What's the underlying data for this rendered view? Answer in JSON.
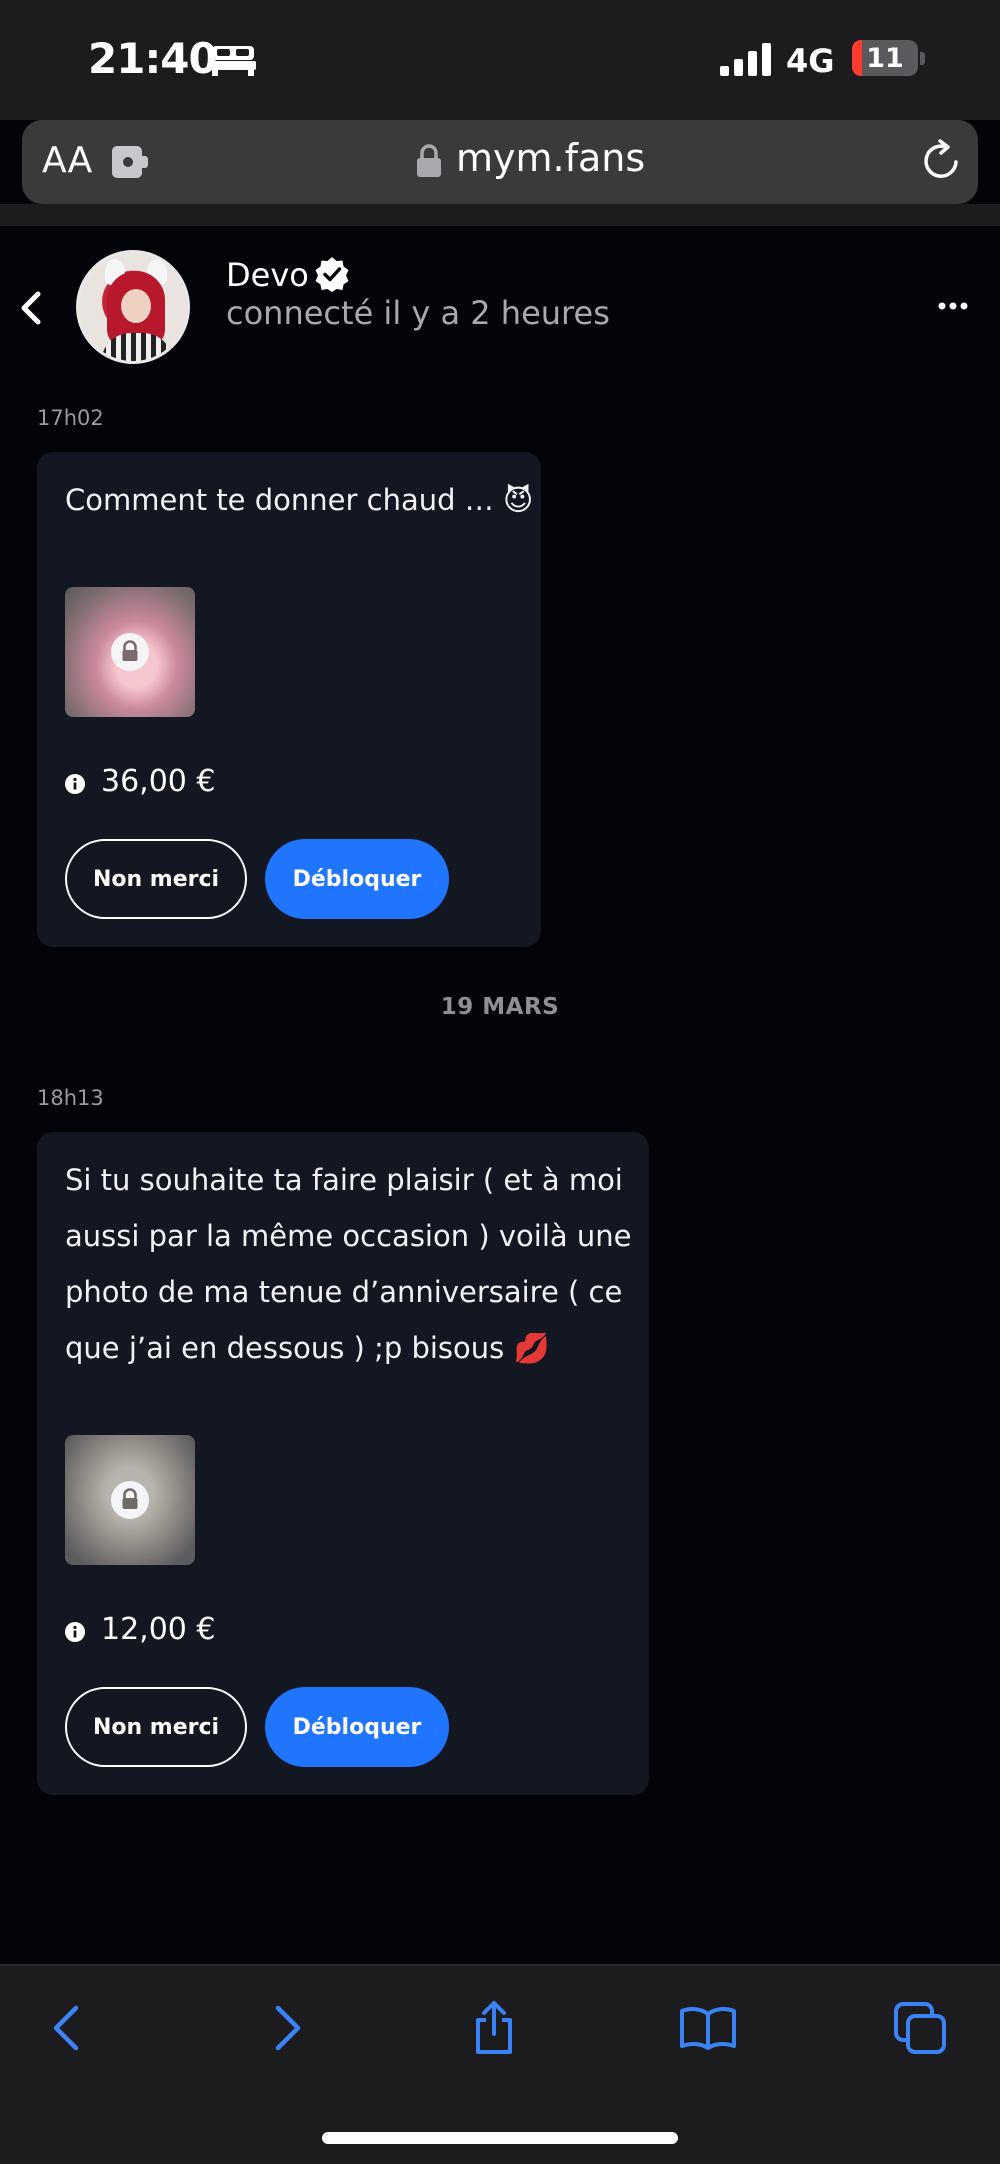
{
  "status_bar": {
    "time": "21:40",
    "network": "4G",
    "battery_level": "11",
    "battery_fraction": 0.11,
    "icons": [
      "bed-icon",
      "signal-icon"
    ]
  },
  "browser": {
    "text_size_button": "AA",
    "url": "mym.fans",
    "icons": [
      "extension-icon",
      "lock-icon",
      "reload-icon"
    ]
  },
  "chat_header": {
    "contact_name": "Devo",
    "contact_status": "connecté il y a 2 heures",
    "icons": [
      "back-chevron-icon",
      "verified-badge-icon",
      "more-options-icon"
    ]
  },
  "messages": [
    {
      "time": "17h02",
      "lines": [
        "Comment te donner chaud … 😈"
      ],
      "price": "36,00 €",
      "decline_label": "Non merci",
      "unlock_label": "Débloquer"
    },
    {
      "time": "18h13",
      "lines": [
        "Si tu souhaite ta faire plaisir ( et à moi",
        "aussi par la même occasion ) voilà une",
        "photo de ma tenue d’anniversaire ( ce",
        "que j’ai en dessous ) ;p bisous 💋"
      ],
      "price": "12,00 €",
      "decline_label": "Non merci",
      "unlock_label": "Débloquer"
    }
  ],
  "date_separator": "19 MARS",
  "toolbar": {
    "icons": [
      "back-arrow-icon",
      "forward-arrow-icon",
      "share-icon",
      "bookmarks-icon",
      "tabs-icon"
    ]
  },
  "colors": {
    "accent_blue": "#1f75fe",
    "bubble_bg": "#121721",
    "page_bg": "#02040a",
    "battery_low": "#ff3b30",
    "toolbar_blue": "#3b82f6"
  }
}
